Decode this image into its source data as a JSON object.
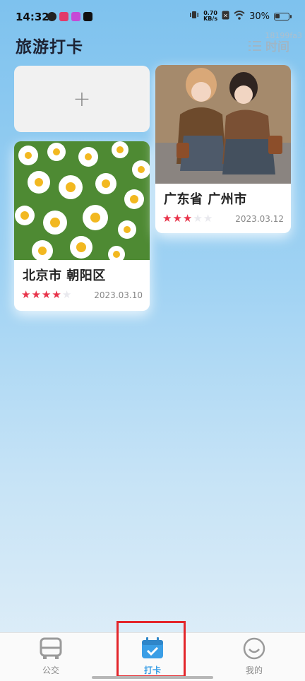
{
  "status_bar": {
    "time": "14:32",
    "network_speed_value": "0.70",
    "network_speed_unit": "KB/s",
    "battery": "30%"
  },
  "header": {
    "title": "旅游打卡",
    "watermark": "18199fa3",
    "sort_label": "时间"
  },
  "add_card": {
    "label": "+"
  },
  "cards": [
    {
      "location": "广东省 广州市",
      "rating": 3,
      "max_rating": 5,
      "date": "2023.03.12"
    },
    {
      "location": "北京市 朝阳区",
      "rating": 4,
      "max_rating": 5,
      "date": "2023.03.10"
    }
  ],
  "bottom_nav": {
    "items": [
      {
        "label": "公交",
        "icon": "bus-icon"
      },
      {
        "label": "打卡",
        "icon": "calendar-check-icon",
        "active": true
      },
      {
        "label": "我的",
        "icon": "smile-icon"
      }
    ]
  },
  "colors": {
    "accent": "#3a9ee6",
    "star_on": "#e8334a",
    "highlight": "#e3262b"
  }
}
